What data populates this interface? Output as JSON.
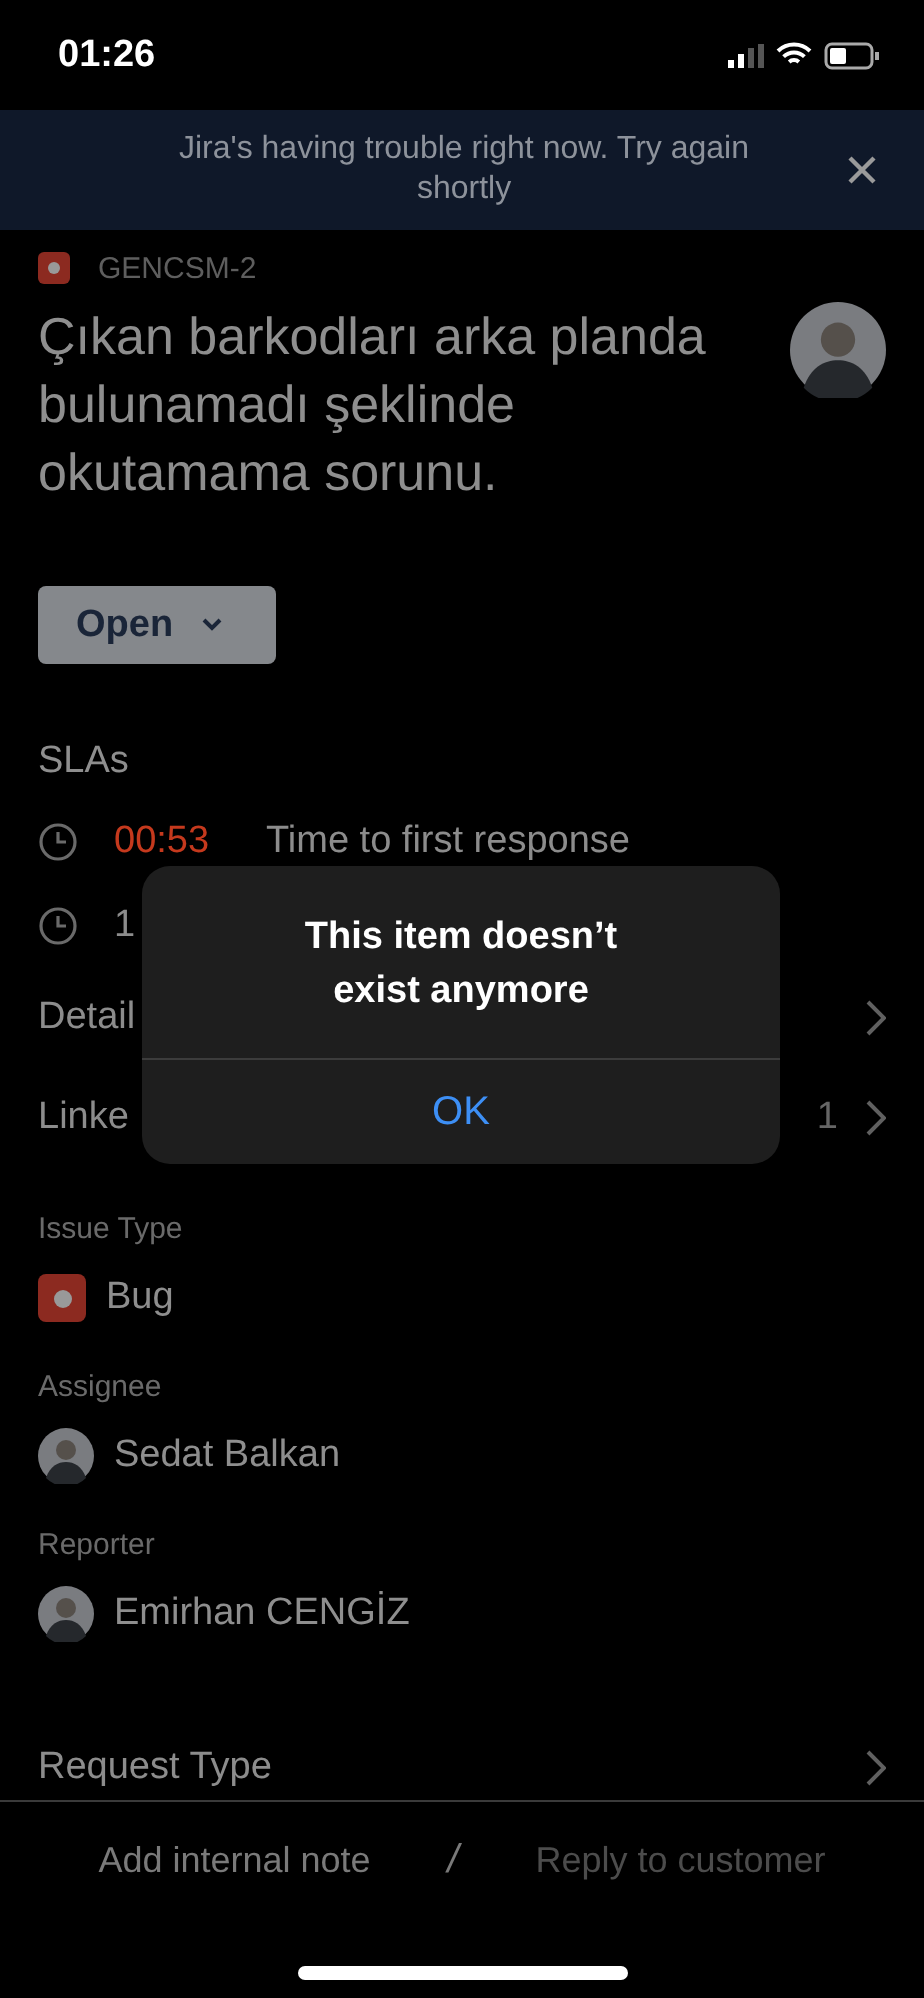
{
  "status_bar": {
    "time": "01:26"
  },
  "banner": {
    "message": "Jira's having trouble right now. Try again shortly"
  },
  "issue": {
    "key": "GENCSM-2",
    "title": "Çıkan barkodları arka planda bulunamadı şeklinde okutamama sorunu.",
    "status": "Open"
  },
  "slas_heading": "SLAs",
  "slas": [
    {
      "time": "00:53",
      "label": "Time to first response",
      "color": "#c5391d"
    },
    {
      "time": "1",
      "color": "#8c8c8c"
    }
  ],
  "nav_rows": [
    {
      "label": "Detail"
    },
    {
      "label": "Linke",
      "count": "1"
    }
  ],
  "fields": [
    {
      "kind": "issue-type",
      "label": "Issue Type",
      "value": "Bug"
    },
    {
      "kind": "person",
      "label": "Assignee",
      "value": "Sedat Balkan"
    },
    {
      "kind": "person",
      "label": "Reporter",
      "value": "Emirhan CENGİZ"
    }
  ],
  "request_type": {
    "label": "Request Type"
  },
  "bottom_bar": {
    "separator": "/",
    "actions": [
      {
        "label": "Add internal note",
        "disabled": false
      },
      {
        "label": "Reply to customer",
        "disabled": true
      }
    ]
  },
  "dialog": {
    "message": "This item doesn’t exist anymore",
    "button": "OK"
  }
}
